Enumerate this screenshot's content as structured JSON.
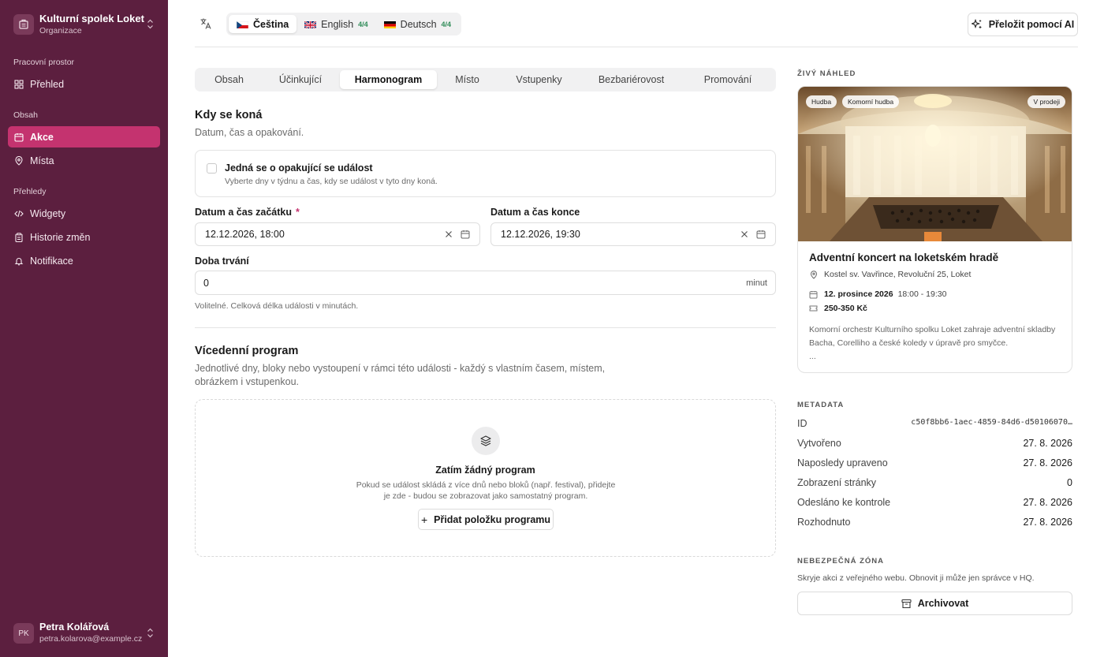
{
  "org": {
    "name": "Kulturní spolek Loket",
    "subtitle": "Organizace"
  },
  "sidebar": {
    "sections": [
      {
        "label": "Pracovní prostor"
      },
      {
        "label": "Obsah"
      },
      {
        "label": "Přehledy"
      }
    ],
    "items": [
      {
        "label": "Přehled",
        "icon": "grid-icon"
      },
      {
        "label": "Akce",
        "icon": "calendar-icon",
        "active": true
      },
      {
        "label": "Místa",
        "icon": "map-pin-icon"
      },
      {
        "label": "Widgety",
        "icon": "code-icon"
      },
      {
        "label": "Historie změn",
        "icon": "clipboard-icon"
      },
      {
        "label": "Notifikace",
        "icon": "bell-icon"
      }
    ]
  },
  "user": {
    "initials": "PK",
    "name": "Petra Kolářová",
    "email": "petra.kolarova@example.cz"
  },
  "languages": [
    {
      "label": "Čeština",
      "count": "",
      "active": true
    },
    {
      "label": "English",
      "count": "4/4"
    },
    {
      "label": "Deutsch",
      "count": "4/4"
    }
  ],
  "ai_button": "Přeložit pomocí AI",
  "tabs": [
    "Obsah",
    "Účinkující",
    "Harmonogram",
    "Místo",
    "Vstupenky",
    "Bezbariérovost",
    "Promování"
  ],
  "active_tab": "Harmonogram",
  "when": {
    "title": "Kdy se koná",
    "subtitle": "Datum, čas a opakování.",
    "recurring_title": "Jedná se o opakující se událost",
    "recurring_sub": "Vyberte dny v týdnu a čas, kdy se událost v tyto dny koná.",
    "start_label": "Datum a čas začátku",
    "required_mark": "*",
    "start_value": "12.12.2026, 18:00",
    "end_label": "Datum a čas konce",
    "end_value": "12.12.2026, 19:30",
    "duration_label": "Doba trvání",
    "duration_value": "0",
    "duration_suffix": "minut",
    "duration_hint": "Volitelné. Celková délka události v minutách."
  },
  "program": {
    "title": "Vícedenní program",
    "subtitle_line1": "Jednotlivé dny, bloky nebo vystoupení v rámci této události - každý s vlastním časem, místem,",
    "subtitle_line2": "obrázkem i vstupenkou.",
    "empty_title": "Zatím žádný program",
    "empty_text": "Pokud se událost skládá z více dnů nebo bloků (např. festival), přidejte je zde - budou se zobrazovat jako samostatný program.",
    "add_button": "Přidat položku programu"
  },
  "preview": {
    "caption": "ŽIVÝ NÁHLED",
    "chips": [
      "Hudba",
      "Komorní hudba"
    ],
    "status_chip": "V prodeji",
    "title": "Adventní koncert na loketském hradě",
    "location": "Kostel sv. Vavřince, Revoluční 25, Loket",
    "date": "12. prosince 2026",
    "time": "18:00 - 19:30",
    "price": "250-350 Kč",
    "description": "Komorní orchestr Kulturního spolku Loket zahraje adventní skladby Bacha, Corelliho a české koledy v úpravě pro smyčce.",
    "ellipsis": "..."
  },
  "metadata": {
    "caption": "METADATA",
    "rows": [
      {
        "label": "ID",
        "value": "c50f8bb6-1aec-4859-84d6-d50106070…"
      },
      {
        "label": "Vytvořeno",
        "value": "27. 8. 2026"
      },
      {
        "label": "Naposledy upraveno",
        "value": "27. 8. 2026"
      },
      {
        "label": "Zobrazení stránky",
        "value": "0"
      },
      {
        "label": "Odesláno ke kontrole",
        "value": "27. 8. 2026"
      },
      {
        "label": "Rozhodnuto",
        "value": "27. 8. 2026"
      }
    ]
  },
  "danger": {
    "caption": "NEBEZPEČNÁ ZÓNA",
    "text": "Skryje akci z veřejného webu. Obnovit ji může jen správce v HQ.",
    "button": "Archivovat"
  },
  "colors": {
    "sidebar": "#5c1f3f",
    "accent": "#c4336f",
    "success": "#2e8b57"
  }
}
